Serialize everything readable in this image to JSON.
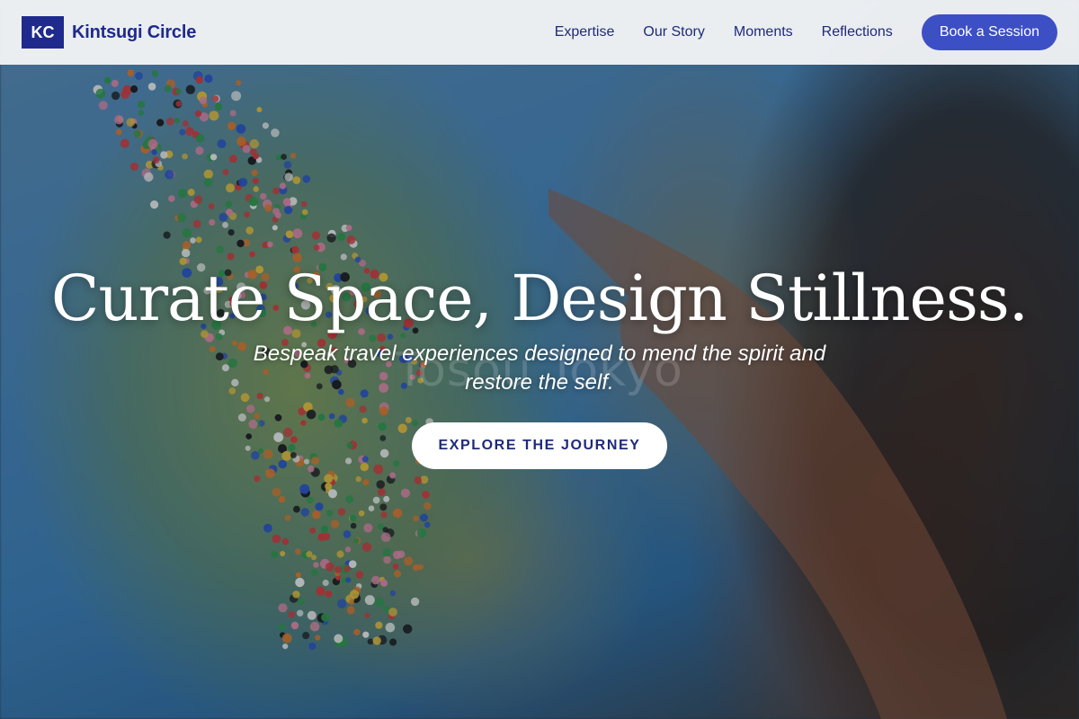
{
  "header": {
    "logo_text": "KC",
    "brand_name": "Kintsugi Circle",
    "nav": [
      {
        "label": "Expertise"
      },
      {
        "label": "Our Story"
      },
      {
        "label": "Moments"
      },
      {
        "label": "Reflections"
      }
    ],
    "cta_label": "Book a Session"
  },
  "hero": {
    "title": "Curate Space, Design Stillness.",
    "subtitle": "Bespeak travel experiences designed to mend the spirit and restore the self.",
    "cta_label": "EXPLORE THE JOURNEY",
    "background_watermark": "Tosou Tokyo"
  },
  "colors": {
    "brand": "#1f2a8c",
    "nav_text": "#1f2a7a",
    "cta_background": "#3d4fc4",
    "hero_cta_background": "#ffffff"
  }
}
